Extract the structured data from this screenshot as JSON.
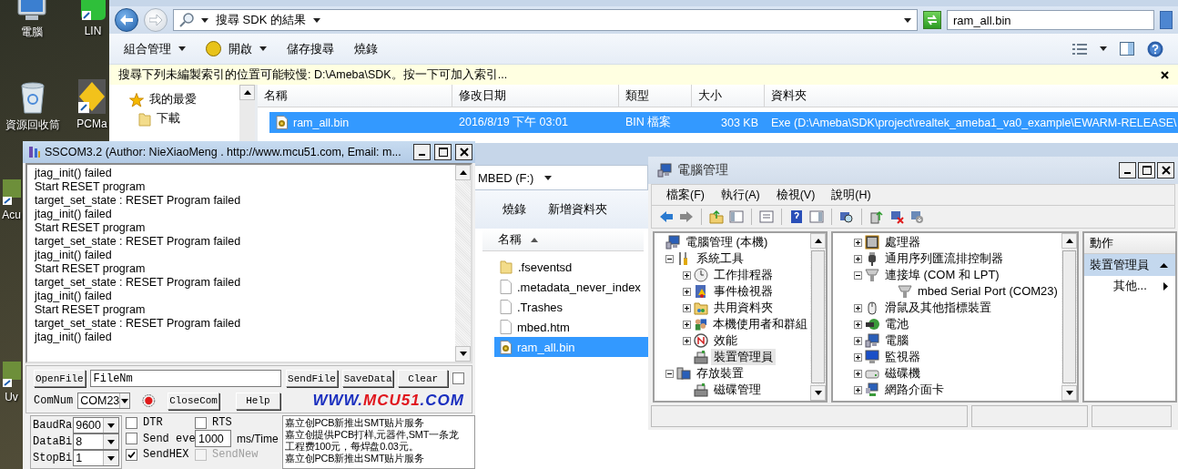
{
  "desktop_icons": [
    {
      "label": "電腦"
    },
    {
      "label": "LIN"
    },
    {
      "label": "資源回收筒"
    },
    {
      "label": "PCMa"
    },
    {
      "label": "Acu"
    },
    {
      "label": "Uv"
    }
  ],
  "search_window": {
    "address": "搜尋 SDK 的結果",
    "search_value": "ram_all.bin",
    "toolbar": [
      {
        "label": "組合管理",
        "dropdown": true
      },
      {
        "label": "開啟",
        "dropdown": true
      },
      {
        "label": "儲存搜尋",
        "dropdown": false
      },
      {
        "label": "燒錄",
        "dropdown": false
      }
    ],
    "info_bar": "搜尋下列未編製索引的位置可能較慢: D:\\Ameba\\SDK。按一下可加入索引...",
    "nav_items": [
      {
        "label": "我的最愛"
      },
      {
        "label": "下載"
      }
    ],
    "columns": [
      "名稱",
      "修改日期",
      "類型",
      "大小",
      "資料夾"
    ],
    "rows": [
      {
        "selected": true,
        "cells": [
          "ram_all.bin",
          "2016/8/19 下午 03:01",
          "BIN 檔案",
          "303 KB",
          "Exe (D:\\Ameba\\SDK\\project\\realtek_ameba1_va0_example\\EWARM-RELEASE\\"
        ]
      }
    ]
  },
  "drive_window": {
    "address": "MBED (F:)",
    "toolbar": [
      "燒錄",
      "新增資料夾"
    ],
    "column": "名稱",
    "files": [
      {
        "name": ".fseventsd",
        "kind": "folder",
        "selected": false
      },
      {
        "name": ".metadata_never_index",
        "kind": "file",
        "selected": false
      },
      {
        "name": ".Trashes",
        "kind": "file",
        "selected": false
      },
      {
        "name": "mbed.htm",
        "kind": "file",
        "selected": false
      },
      {
        "name": "ram_all.bin",
        "kind": "binary",
        "selected": true
      }
    ]
  },
  "sscom": {
    "title": "SSCOM3.2 (Author: NieXiaoMeng .  http://www.mcu51.com,  Email: m...",
    "output": [
      "jtag_init() failed",
      "Start RESET program",
      "target_set_state : RESET Program failed",
      "jtag_init() failed",
      "Start RESET program",
      "target_set_state : RESET Program failed",
      "jtag_init() failed",
      "Start RESET program",
      "target_set_state : RESET Program failed",
      "jtag_init() failed",
      "Start RESET program",
      "target_set_state : RESET Program failed",
      "jtag_init() failed"
    ],
    "open_file": "OpenFile",
    "file_name": "FileNm",
    "buttons": [
      "SendFile",
      "SaveData",
      "Clear"
    ],
    "extra_check": {
      "checked": false
    },
    "com_label": "ComNum",
    "com_value": "COM23",
    "port_open": true,
    "close_com": "CloseCom",
    "help": "Help",
    "logo": [
      {
        "text": "WWW.",
        "color": "#1a2fbf"
      },
      {
        "text": "MCU51",
        "color": "#e0161d"
      },
      {
        "text": ".COM",
        "color": "#1a2fbf"
      }
    ],
    "settings": [
      {
        "label": "BaudRa",
        "value": "9600"
      },
      {
        "label": "DataBi",
        "value": "8"
      },
      {
        "label": "StopBi",
        "value": "1"
      }
    ],
    "options": [
      {
        "label": "DTR",
        "checked": false,
        "disabled": false
      },
      {
        "label": "RTS",
        "checked": false,
        "disabled": false
      },
      {
        "label": "Send eve",
        "checked": false,
        "disabled": false
      },
      {
        "label": "SendHEX",
        "checked": true,
        "disabled": false
      },
      {
        "label": "SendNew",
        "checked": false,
        "disabled": true
      }
    ],
    "interval": "1000",
    "interval_unit": "ms/Time",
    "ad_lines": [
      "嘉立创PCB新推出SMT贴片服务",
      "嘉立创提供PCB打样,元器件,SMT一条龙",
      "工程费100元，每焊盘0.03元。",
      "嘉立创PCB新推出SMT贴片服务"
    ]
  },
  "comp_mgmt": {
    "title": "電腦管理",
    "menu": [
      "檔案(F)",
      "執行(A)",
      "檢視(V)",
      "說明(H)"
    ],
    "left_tree": [
      {
        "label": "電腦管理 (本機)",
        "selected": false,
        "children": [
          {
            "label": "系統工具",
            "expanded": true,
            "selected": false,
            "children": [
              {
                "label": "工作排程器",
                "expanded": false,
                "selected": false
              },
              {
                "label": "事件檢視器",
                "expanded": false,
                "selected": false
              },
              {
                "label": "共用資料夾",
                "expanded": false,
                "selected": false
              },
              {
                "label": "本機使用者和群組",
                "expanded": false,
                "selected": false
              },
              {
                "label": "效能",
                "expanded": false,
                "selected": false
              },
              {
                "label": "裝置管理員",
                "selected": true
              }
            ]
          },
          {
            "label": "存放裝置",
            "expanded": true,
            "selected": false,
            "children": [
              {
                "label": "磁碟管理",
                "selected": false
              }
            ]
          }
        ]
      }
    ],
    "device_tree": [
      {
        "label": "處理器",
        "expanded": false
      },
      {
        "label": "通用序列匯流排控制器",
        "expanded": false
      },
      {
        "label": "連接埠 (COM 和 LPT)",
        "expanded": true,
        "children": [
          {
            "label": "mbed Serial Port (COM23)"
          }
        ]
      },
      {
        "label": "滑鼠及其他指標裝置",
        "expanded": false
      },
      {
        "label": "電池",
        "expanded": false
      },
      {
        "label": "電腦",
        "expanded": false
      },
      {
        "label": "監視器",
        "expanded": false
      },
      {
        "label": "磁碟機",
        "expanded": false
      },
      {
        "label": "網路介面卡",
        "expanded": false
      }
    ],
    "actions": {
      "header": "動作",
      "section": "裝置管理員",
      "items": [
        "其他..."
      ]
    }
  }
}
